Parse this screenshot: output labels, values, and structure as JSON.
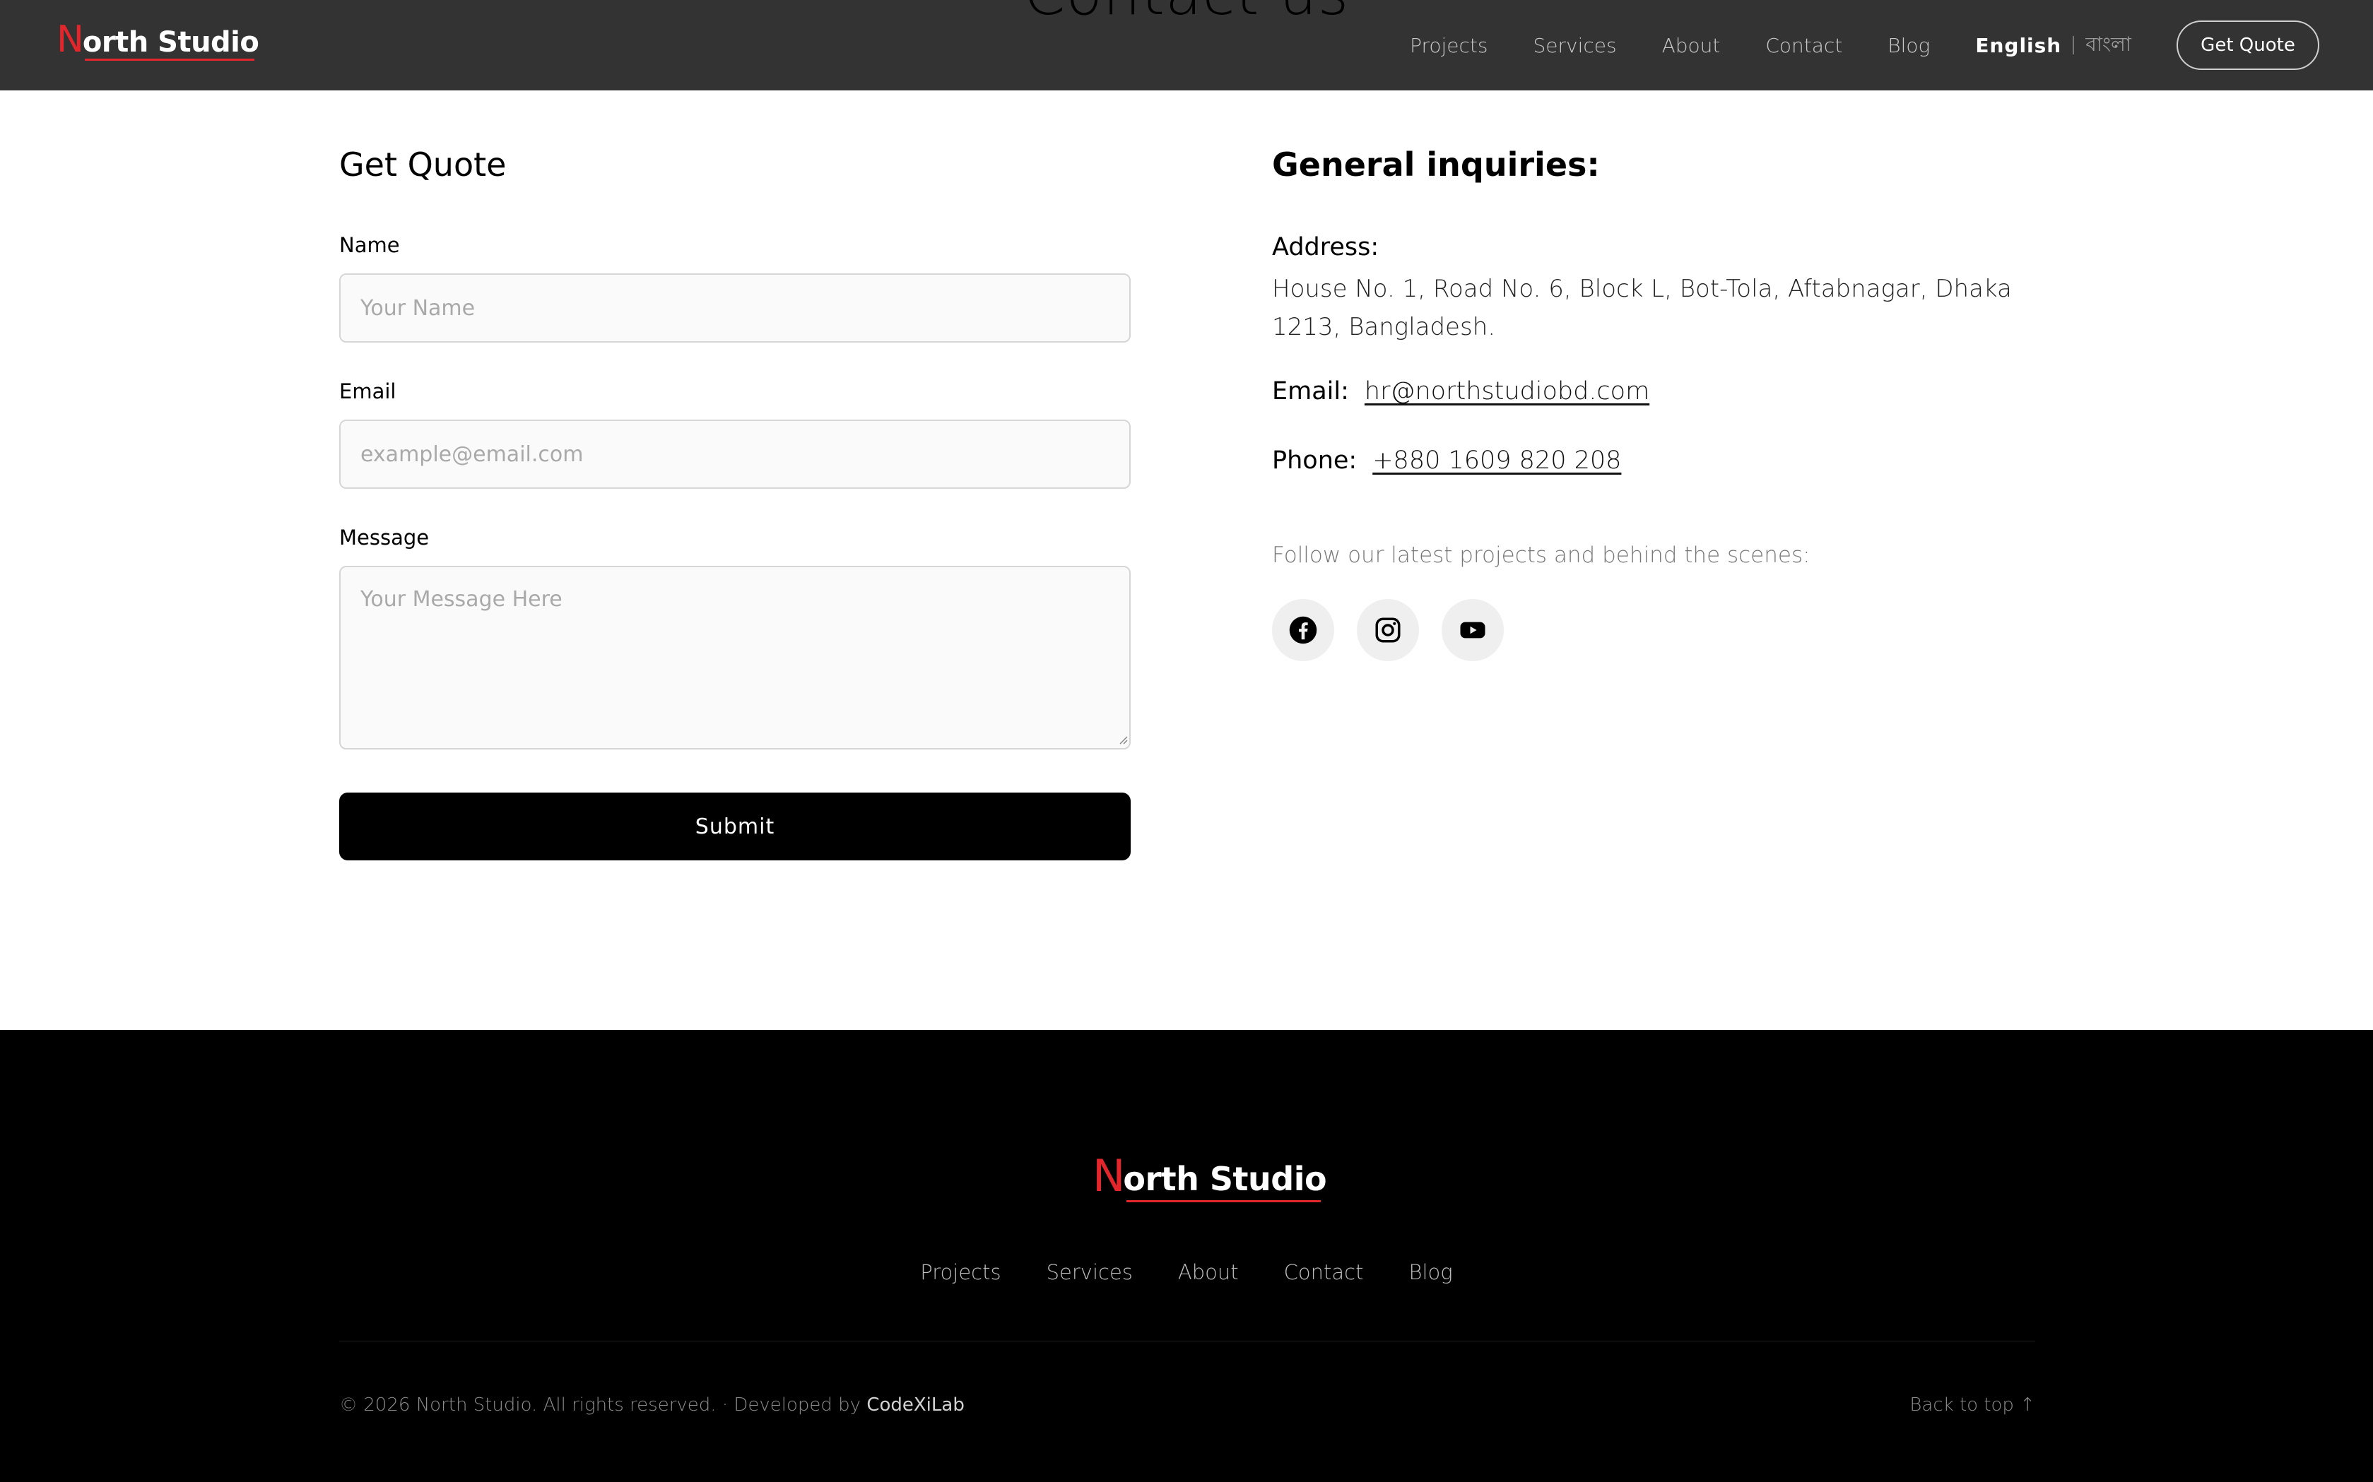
{
  "header": {
    "hero_title": "Contact us",
    "logo": {
      "n": "N",
      "rest": "orth Studio"
    },
    "nav": [
      "Projects",
      "Services",
      "About",
      "Contact",
      "Blog"
    ],
    "language": {
      "active": "English",
      "alternate": "বাংলা"
    },
    "quote_button": "Get Quote"
  },
  "form": {
    "title": "Get Quote",
    "name": {
      "label": "Name",
      "placeholder": "Your Name"
    },
    "email": {
      "label": "Email",
      "placeholder": "example@email.com"
    },
    "message": {
      "label": "Message",
      "placeholder": "Your Message Here"
    },
    "submit": "Submit"
  },
  "inquiries": {
    "title": "General inquiries:",
    "address_label": "Address:",
    "address": "House No. 1, Road No. 6, Block L, Bot-Tola, Aftabnagar, Dhaka 1213, Bangladesh.",
    "email_label": "Email:",
    "email": "hr@northstudiobd.com",
    "phone_label": "Phone:",
    "phone": "+880 1609 820 208",
    "follow_text": "Follow our latest projects and behind the scenes:",
    "socials": [
      "facebook-icon",
      "instagram-icon",
      "youtube-icon"
    ]
  },
  "footer": {
    "logo": {
      "n": "N",
      "rest": "orth Studio"
    },
    "nav": [
      "Projects",
      "Services",
      "About",
      "Contact",
      "Blog"
    ],
    "copyright": "© 2026 North Studio. All rights reserved. · Developed by ",
    "developer": "CodeXiLab",
    "back_to_top": "Back to top ↑"
  },
  "colors": {
    "header_bg": "#333333",
    "accent_red": "#e3262c",
    "footer_bg": "#000000",
    "field_bg": "#fafafa"
  }
}
